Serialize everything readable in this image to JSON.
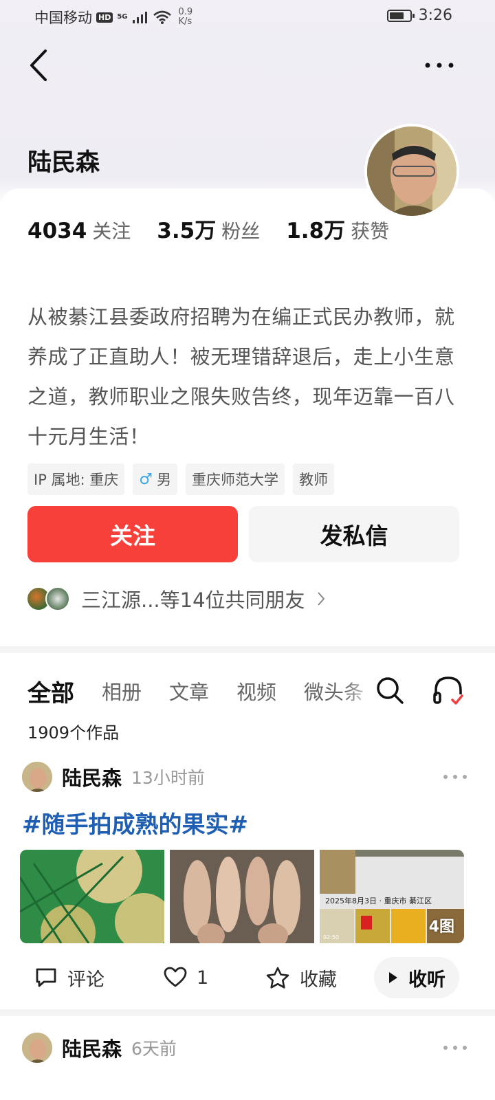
{
  "status_bar": {
    "carrier": "中国移动",
    "hd": "HD",
    "signal": "5G",
    "speed_value": "0.9",
    "speed_unit": "K/s",
    "time": "3:26"
  },
  "profile": {
    "name": "陆民森",
    "stats": [
      {
        "value": "4034",
        "label": "关注"
      },
      {
        "value": "3.5万",
        "label": "粉丝"
      },
      {
        "value": "1.8万",
        "label": "获赞"
      }
    ],
    "bio": "从被綦江县委政府招聘为在编正式民办教师，就养成了正直助人！被无理错辞退后，走上小生意之道，教师职业之限失败告终，现年迈靠一百八十元月生活！",
    "tags": {
      "ip": "IP 属地: 重庆",
      "gender": "男",
      "school": "重庆师范大学",
      "job": "教师"
    },
    "follow_label": "关注",
    "message_label": "发私信",
    "mutual_text": "三江源...等14位共同朋友"
  },
  "tabs": [
    "全部",
    "相册",
    "文章",
    "视频",
    "微头条"
  ],
  "works_count": "1909个作品",
  "posts": [
    {
      "author": "陆民森",
      "time": "13小时前",
      "title": "#随手拍成熟的果实#",
      "photo_count": "4图",
      "photo_caption": "2025年8月3日 · 重庆市 綦江区",
      "photo_time": "02:50",
      "actions": {
        "comment": "评论",
        "like": "1",
        "favorite": "收藏",
        "listen": "收听"
      }
    },
    {
      "author": "陆民森",
      "time": "6天前"
    }
  ],
  "colors": {
    "follow": "#f8403a",
    "link": "#1f5fb3"
  }
}
